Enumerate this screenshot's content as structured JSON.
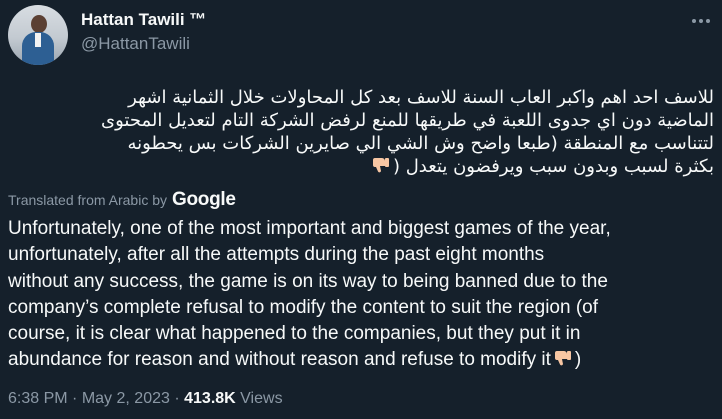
{
  "author": {
    "name": "Hattan Tawili ™",
    "handle": "@HattanTawili"
  },
  "tweet": {
    "arabic_lines": [
      "للاسف احد اهم واكبر العاب السنة للاسف بعد كل المحاولات خلال الثمانية اشهر",
      "الماضية دون اي جدوى  اللعبة في طريقها للمنع لرفض الشركة التام لتعديل المحتوى",
      "لتتناسب مع المنطقة (طبعا واضح وش الشي الي صايرين الشركات بس يحطونه",
      "بكثرة لسبب وبدون سبب ويرفضون يتعدل"
    ],
    "translated_label": "Translated from Arabic by",
    "translator": "Google",
    "translation_lines": [
      "Unfortunately, one of the most important and biggest games of the year,",
      "unfortunately, after all the attempts during the past eight months",
      "without any success, the game is on its way to being banned due to the",
      "company’s complete refusal to modify the content to suit the region (of",
      "course, it is clear what happened to the companies, but they put it in",
      "abundance for reason and without reason and refuse to modify it"
    ],
    "translation_end": ")"
  },
  "meta": {
    "time": "6:38 PM",
    "date": "May 2, 2023",
    "views_count": "413.8K",
    "views_label": "Views",
    "separator": "·"
  },
  "icons": {
    "emoji": "thumbs-down-icon",
    "more": "more-dots-icon"
  },
  "colors": {
    "background": "#15202b",
    "text": "#f7f9f9",
    "muted": "#8b98a5",
    "emoji_skin": "#f7c6a3"
  }
}
